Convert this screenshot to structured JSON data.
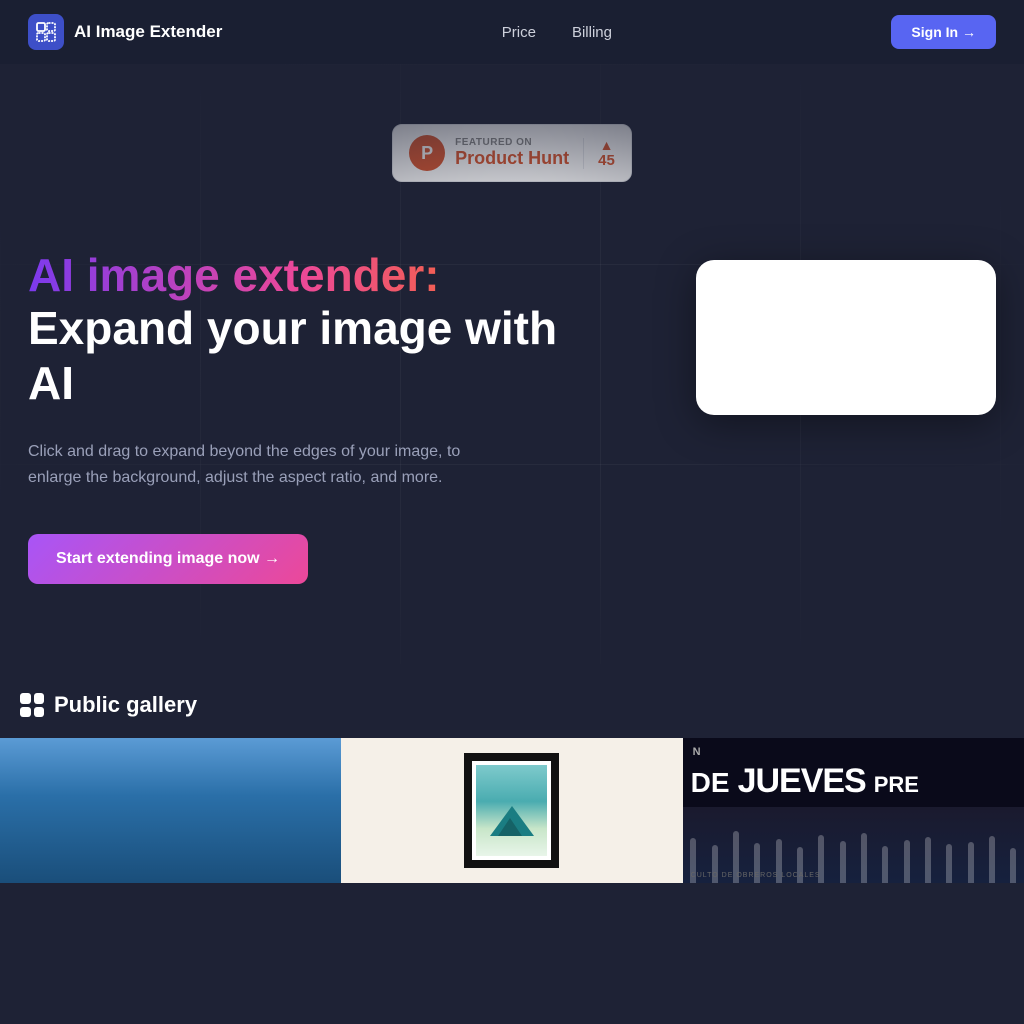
{
  "nav": {
    "logo_label": "AI Image Extender",
    "links": [
      {
        "label": "Price",
        "href": "#"
      },
      {
        "label": "Billing",
        "href": "#"
      }
    ],
    "signin_label": "Sign In →"
  },
  "product_hunt": {
    "featured_label": "FEATURED ON",
    "name": "Product Hunt",
    "votes": "45"
  },
  "hero": {
    "gradient_heading": "AI image extender:",
    "white_heading": "Expand your image with AI",
    "description": "Click and drag to expand beyond the edges of your image, to enlarge the background, adjust the aspect ratio, and more.",
    "cta_label": "Start extending image now →"
  },
  "gallery": {
    "title": "Public gallery",
    "jueves": {
      "prefix": "DE",
      "main": "JUEVES",
      "suffix": "PRE",
      "subtitle": "CULTO DE OBREROS LOCALES"
    }
  }
}
